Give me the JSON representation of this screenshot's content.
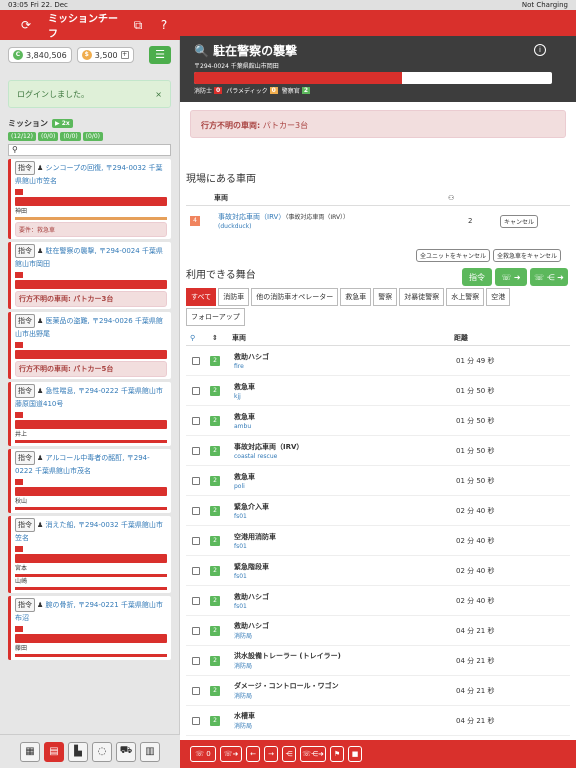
{
  "status": {
    "time": "03:05",
    "date": "Fri 22. Dec",
    "battery": "Not Charging"
  },
  "app": {
    "title": "ミッションチーフ"
  },
  "resources": {
    "credits": "3,840,506",
    "coins": "3,500"
  },
  "alert": {
    "text": "ログインしました。",
    "close": "×"
  },
  "missions_header": {
    "label": "ミッション",
    "speed": "▶ 2x",
    "filters": [
      "(12/12)",
      "(0/0)",
      "(0/0)",
      "(0/0)"
    ]
  },
  "missions": [
    {
      "title": "シンコープの回復,",
      "addr": "〒294-0032 千葉県館山市笠名",
      "btn": "指令",
      "unit1": "神田",
      "need": "要件：救急車",
      "need_bold": false
    },
    {
      "title": "駐在警察の襲撃,",
      "addr": "〒294-0024 千葉県館山市岡田",
      "btn": "指令",
      "unit1": "",
      "need": "行方不明の車両: パトカー3台",
      "need_bold": true
    },
    {
      "title": "医薬品の盗難,",
      "addr": "〒294-0026 千葉県館山市出野尾",
      "btn": "指令",
      "unit1": "",
      "need": "行方不明の車両: パトカー5台",
      "need_bold": true
    },
    {
      "title": "急性喘息,",
      "addr": "〒294-0222 千葉県館山市藤原国道410号",
      "btn": "指令",
      "unit1": "井上",
      "need": "",
      "need_bold": false
    },
    {
      "title": "アルコール中毒者の酩酊,",
      "addr": "〒294-0222 千葉県館山市茂名",
      "btn": "指令",
      "unit1": "秋山",
      "need": "",
      "need_bold": false
    },
    {
      "title": "消えた船,",
      "addr": "〒294-0032 千葉県館山市笠名",
      "btn": "指令",
      "unit1": "宮本",
      "unit2": "山崎",
      "need": "",
      "need_bold": false
    },
    {
      "title": "腕の骨折,",
      "addr": "〒294-0221 千葉県館山市布沼",
      "btn": "指令",
      "unit1": "藤田",
      "need": "",
      "need_bold": false
    }
  ],
  "detail": {
    "title": "駐在警察の襲撃",
    "address": "〒294-0024 千葉県館山市岡田",
    "progress": 0.58,
    "personnel": [
      {
        "label": "消防士",
        "n": "0",
        "color": "#d9302c"
      },
      {
        "label": "パラメディック",
        "n": "0",
        "color": "#f0ad4e"
      },
      {
        "label": "警察官",
        "n": "2",
        "color": "#5cb85c"
      }
    ],
    "missing_label": "行方不明の車両:",
    "missing_value": "パトカー3台"
  },
  "onsite": {
    "heading": "現場にある車両",
    "col_vehicle": "車両",
    "rows": [
      {
        "count": "4",
        "name": "事故対応車両（IRV）",
        "type": "（事故対応車両（IRV））",
        "owner": "(duckduck)",
        "people": "2",
        "cancel": "キャンセル"
      }
    ],
    "cancel_all_units": "全ユニットをキャンセル",
    "cancel_all_ambulances": "全救急車をキャンセル"
  },
  "available": {
    "heading": "利用できる舞台",
    "dispatch": "指令",
    "tabs": [
      "すべて",
      "消防車",
      "他の消防車オペレーター",
      "救急車",
      "警察",
      "対暴徒警察",
      "水上警察",
      "空港",
      "フォローアップ"
    ],
    "col_vehicle": "車両",
    "col_distance": "距離",
    "rows": [
      {
        "n": "2",
        "name": "救助ハシゴ",
        "sub": "fire",
        "dist": "01 分 49 秒"
      },
      {
        "n": "2",
        "name": "救急車",
        "sub": "kjj",
        "dist": "01 分 50 秒"
      },
      {
        "n": "2",
        "name": "救急車",
        "sub": "ambu",
        "dist": "01 分 50 秒"
      },
      {
        "n": "2",
        "name": "事故対応車両（IRV）",
        "sub": "coastal rescue",
        "dist": "01 分 50 秒"
      },
      {
        "n": "2",
        "name": "救急車",
        "sub": "poli",
        "dist": "01 分 50 秒"
      },
      {
        "n": "2",
        "name": "緊急介入車",
        "sub": "fs01",
        "dist": "02 分 40 秒"
      },
      {
        "n": "2",
        "name": "空港用消防車",
        "sub": "fs01",
        "dist": "02 分 40 秒"
      },
      {
        "n": "2",
        "name": "緊急階段車",
        "sub": "fs01",
        "dist": "02 分 40 秒"
      },
      {
        "n": "2",
        "name": "救助ハシゴ",
        "sub": "fs01",
        "dist": "02 分 40 秒"
      },
      {
        "n": "2",
        "name": "救助ハシゴ",
        "sub": "消防局",
        "dist": "04 分 21 秒"
      },
      {
        "n": "2",
        "name": "洪水設備トレーラー (トレイラー)",
        "sub": "消防局",
        "dist": "04 分 21 秒"
      },
      {
        "n": "2",
        "name": "ダメージ・コントロール・ワゴン",
        "sub": "消防局",
        "dist": "04 分 21 秒"
      },
      {
        "n": "2",
        "name": "水槽車",
        "sub": "消防局",
        "dist": "04 分 21 秒"
      }
    ]
  }
}
